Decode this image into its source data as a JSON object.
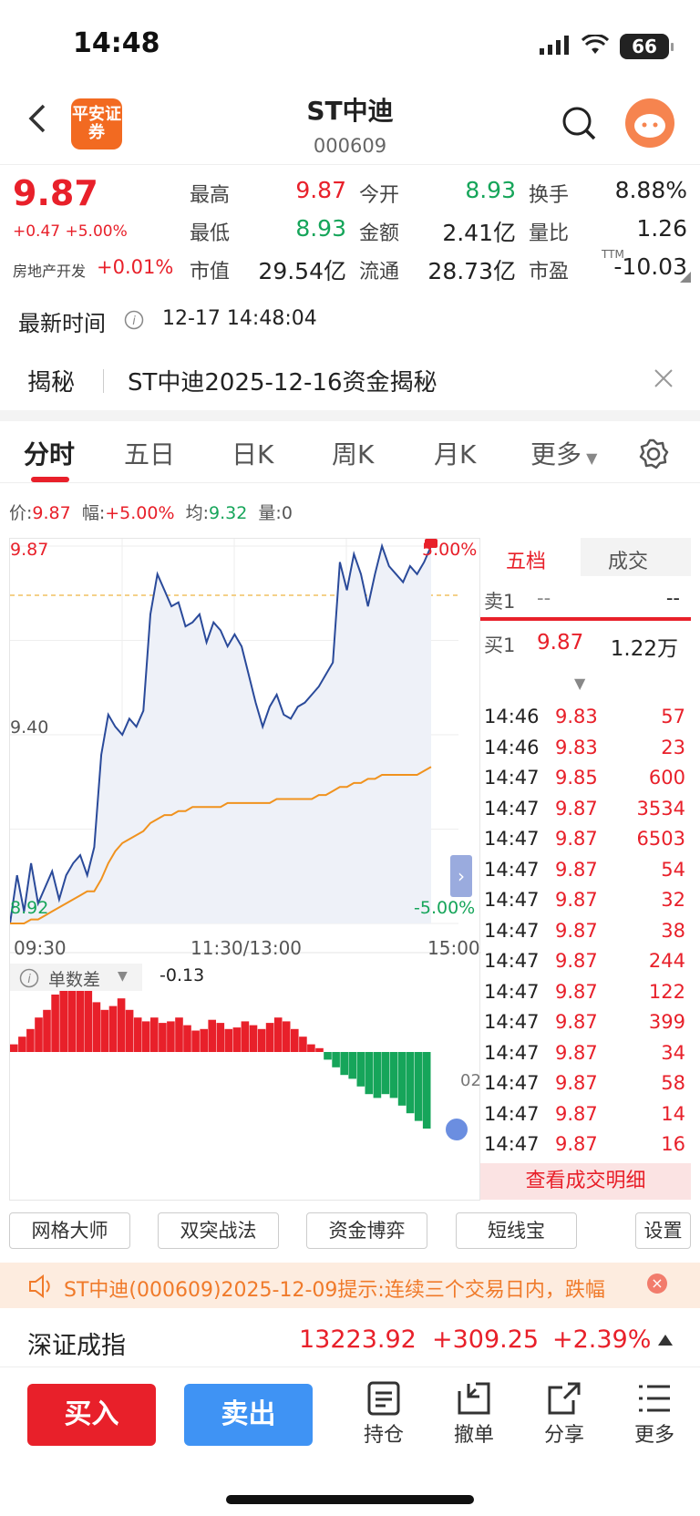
{
  "status_bar": {
    "time": "14:48",
    "battery": "66"
  },
  "header": {
    "logo_text": "平安证券",
    "title": "ST中迪",
    "code": "000609"
  },
  "quote": {
    "price": "9.87",
    "change": "+0.47 +5.00%",
    "sector_label": "房地产开发",
    "sector_change": "+0.01%",
    "fields": [
      {
        "label": "最高",
        "value": "9.87",
        "color": "red"
      },
      {
        "label": "今开",
        "value": "8.93",
        "color": "green"
      },
      {
        "label": "换手",
        "value": "8.88%",
        "color": "black"
      },
      {
        "label": "最低",
        "value": "8.93",
        "color": "green"
      },
      {
        "label": "金额",
        "value": "2.41亿",
        "color": "black"
      },
      {
        "label": "量比",
        "value": "1.26",
        "color": "black"
      },
      {
        "label": "市值",
        "value": "29.54亿",
        "color": "black"
      },
      {
        "label": "流通",
        "value": "28.73亿",
        "color": "black"
      },
      {
        "label": "市盈",
        "value": "-10.03",
        "color": "black"
      }
    ],
    "pe_suffix": "TTM"
  },
  "latest_time": {
    "label": "最新时间",
    "value": "12-17 14:48:04"
  },
  "reveal": {
    "tag": "揭秘",
    "text": "ST中迪2025-12-16资金揭秘"
  },
  "tabs": [
    "分时",
    "五日",
    "日K",
    "周K",
    "月K",
    "更多"
  ],
  "chart_info": {
    "price_label": "价:",
    "price": "9.87",
    "range_label": "幅:",
    "range": "+5.00%",
    "avg_label": "均:",
    "avg": "9.32",
    "vol_label": "量:",
    "vol": "0"
  },
  "chart_data": {
    "type": "line",
    "y_labels": {
      "top": "9.87",
      "mid": "9.40",
      "bottom": "8.92",
      "top_pct": "5.00%",
      "bottom_pct": "-5.00%"
    },
    "x_labels": [
      "09:30",
      "11:30/13:00",
      "15:00"
    ],
    "ylim": [
      8.93,
      9.87
    ],
    "series": [
      {
        "values": [
          8.93,
          9.05,
          8.96,
          9.08,
          8.98,
          9.02,
          9.06,
          8.99,
          9.05,
          9.08,
          9.1,
          9.05,
          9.12,
          9.35,
          9.45,
          9.42,
          9.4,
          9.44,
          9.42,
          9.46,
          9.7,
          9.8,
          9.76,
          9.72,
          9.73,
          9.67,
          9.68,
          9.7,
          9.63,
          9.68,
          9.66,
          9.62,
          9.65,
          9.62,
          9.55,
          9.48,
          9.42,
          9.47,
          9.5,
          9.45,
          9.44,
          9.47,
          9.48,
          9.5,
          9.52,
          9.55,
          9.58,
          9.83,
          9.76,
          9.85,
          9.8,
          9.72,
          9.8,
          9.87,
          9.82,
          9.8,
          9.78,
          9.82,
          9.8,
          9.83,
          9.87
        ]
      },
      {
        "values": [
          8.93,
          8.93,
          8.93,
          8.94,
          8.94,
          8.95,
          8.96,
          8.97,
          8.98,
          8.99,
          9.0,
          9.01,
          9.01,
          9.04,
          9.08,
          9.11,
          9.13,
          9.14,
          9.15,
          9.16,
          9.18,
          9.19,
          9.2,
          9.2,
          9.21,
          9.21,
          9.22,
          9.22,
          9.22,
          9.22,
          9.22,
          9.23,
          9.23,
          9.23,
          9.23,
          9.23,
          9.23,
          9.23,
          9.24,
          9.24,
          9.24,
          9.24,
          9.24,
          9.24,
          9.25,
          9.25,
          9.26,
          9.27,
          9.27,
          9.28,
          9.28,
          9.29,
          9.29,
          9.3,
          9.3,
          9.3,
          9.3,
          9.3,
          9.3,
          9.31,
          9.32
        ]
      }
    ],
    "indicator": {
      "label": "单数差",
      "value": "-0.13",
      "side_label": "02"
    },
    "indicator_values": [
      0.1,
      0.2,
      0.3,
      0.45,
      0.55,
      0.75,
      0.85,
      0.95,
      0.9,
      0.8,
      0.65,
      0.55,
      0.6,
      0.7,
      0.55,
      0.45,
      0.4,
      0.45,
      0.38,
      0.4,
      0.45,
      0.35,
      0.28,
      0.3,
      0.42,
      0.38,
      0.3,
      0.32,
      0.4,
      0.35,
      0.3,
      0.38,
      0.45,
      0.4,
      0.3,
      0.2,
      0.1,
      0.05,
      -0.1,
      -0.2,
      -0.3,
      -0.35,
      -0.45,
      -0.55,
      -0.6,
      -0.55,
      -0.6,
      -0.7,
      -0.8,
      -0.9,
      -1.0
    ]
  },
  "book": {
    "tabs": [
      "五档",
      "成交"
    ],
    "sell1": {
      "label": "卖1",
      "price": "--",
      "vol": "--"
    },
    "buy1": {
      "label": "买1",
      "price": "9.87",
      "vol": "1.22万"
    },
    "trades": [
      {
        "time": "14:46",
        "price": "9.83",
        "vol": "57"
      },
      {
        "time": "14:46",
        "price": "9.83",
        "vol": "23"
      },
      {
        "time": "14:47",
        "price": "9.85",
        "vol": "600"
      },
      {
        "time": "14:47",
        "price": "9.87",
        "vol": "3534"
      },
      {
        "time": "14:47",
        "price": "9.87",
        "vol": "6503"
      },
      {
        "time": "14:47",
        "price": "9.87",
        "vol": "54"
      },
      {
        "time": "14:47",
        "price": "9.87",
        "vol": "32"
      },
      {
        "time": "14:47",
        "price": "9.87",
        "vol": "38"
      },
      {
        "time": "14:47",
        "price": "9.87",
        "vol": "244"
      },
      {
        "time": "14:47",
        "price": "9.87",
        "vol": "122"
      },
      {
        "time": "14:47",
        "price": "9.87",
        "vol": "399"
      },
      {
        "time": "14:47",
        "price": "9.87",
        "vol": "34"
      },
      {
        "time": "14:47",
        "price": "9.87",
        "vol": "58"
      },
      {
        "time": "14:47",
        "price": "9.87",
        "vol": "14"
      },
      {
        "time": "14:47",
        "price": "9.87",
        "vol": "16"
      }
    ],
    "detail_label": "查看成交明细"
  },
  "tools": [
    "网格大师",
    "双突战法",
    "资金博弈",
    "短线宝",
    "设置"
  ],
  "notice": "ST中迪(000609)2025-12-09提示:连续三个交易日内，跌幅",
  "index": {
    "name": "深证成指",
    "value": "13223.92",
    "change": "+309.25",
    "pct": "+2.39%"
  },
  "actions": {
    "buy": "买入",
    "sell": "卖出",
    "items": [
      "持仓",
      "撤单",
      "分享",
      "更多"
    ]
  },
  "colors": {
    "up": "#e8202a",
    "down": "#16a55a",
    "price_line": "#2a4a9a",
    "avg_line": "#f0921e"
  }
}
